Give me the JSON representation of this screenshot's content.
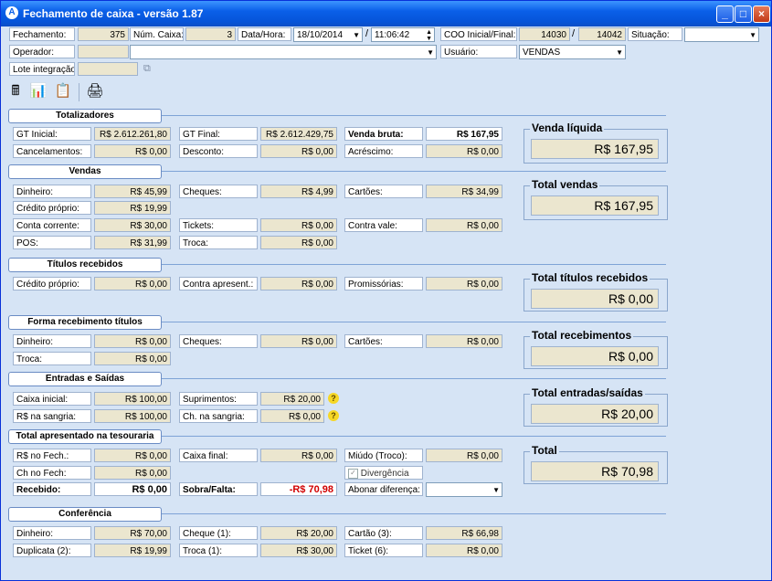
{
  "window": {
    "title": "Fechamento de caixa - versão 1.87"
  },
  "header": {
    "fechamento_label": "Fechamento:",
    "fechamento_value": "375",
    "num_caixa_label": "Núm. Caixa:",
    "num_caixa_value": "3",
    "data_hora_label": "Data/Hora:",
    "date_value": "18/10/2014",
    "date_sep": "/",
    "time_value": "11:06:42",
    "coo_label": "COO Inicial/Final:",
    "coo_inicial": "14030",
    "coo_sep": "/",
    "coo_final": "14042",
    "situacao_label": "Situação:",
    "situacao_value": "",
    "operador_label": "Operador:",
    "operador_value": "",
    "usuario_label": "Usuário:",
    "usuario_value": "VENDAS",
    "lote_label": "Lote integração:",
    "lote_value": ""
  },
  "sections": {
    "totalizadores": "Totalizadores",
    "vendas": "Vendas",
    "titulos": "Títulos recebidos",
    "forma": "Forma recebimento títulos",
    "entradas": "Entradas e Saídas",
    "tesouraria": "Total apresentado na tesouraria",
    "conferencia": "Conferência"
  },
  "totalizadores": {
    "gt_inicial_label": "GT Inicial:",
    "gt_inicial": "R$ 2.612.261,80",
    "gt_final_label": "GT Final:",
    "gt_final": "R$ 2.612.429,75",
    "venda_bruta_label": "Venda bruta:",
    "venda_bruta": "R$ 167,95",
    "cancelamentos_label": "Cancelamentos:",
    "cancelamentos": "R$ 0,00",
    "desconto_label": "Desconto:",
    "desconto": "R$ 0,00",
    "acrescimo_label": "Acréscimo:",
    "acrescimo": "R$ 0,00"
  },
  "vendas": {
    "dinheiro_label": "Dinheiro:",
    "dinheiro": "R$ 45,99",
    "cheques_label": "Cheques:",
    "cheques": "R$ 4,99",
    "cartoes_label": "Cartões:",
    "cartoes": "R$ 34,99",
    "credito_label": "Crédito próprio:",
    "credito": "R$ 19,99",
    "conta_label": "Conta corrente:",
    "conta": "R$ 30,00",
    "tickets_label": "Tickets:",
    "tickets": "R$ 0,00",
    "contravale_label": "Contra vale:",
    "contravale": "R$ 0,00",
    "pos_label": "POS:",
    "pos": "R$ 31,99",
    "troca_label": "Troca:",
    "troca": "R$ 0,00"
  },
  "titulos": {
    "credito_label": "Crédito próprio:",
    "credito": "R$ 0,00",
    "contra_label": "Contra apresent.:",
    "contra": "R$ 0,00",
    "promissorias_label": "Promissórias:",
    "promissorias": "R$ 0,00"
  },
  "forma": {
    "dinheiro_label": "Dinheiro:",
    "dinheiro": "R$ 0,00",
    "cheques_label": "Cheques:",
    "cheques": "R$ 0,00",
    "cartoes_label": "Cartões:",
    "cartoes": "R$ 0,00",
    "troca_label": "Troca:",
    "troca": "R$ 0,00"
  },
  "entradas": {
    "caixa_inicial_label": "Caixa inicial:",
    "caixa_inicial": "R$ 100,00",
    "suprimentos_label": "Suprimentos:",
    "suprimentos": "R$ 20,00",
    "sangria_label": "R$  na sangria:",
    "sangria": "R$ 100,00",
    "ch_sangria_label": "Ch. na sangria:",
    "ch_sangria": "R$ 0,00"
  },
  "tesouraria": {
    "fech_label": "R$ no Fech.:",
    "fech": "R$ 0,00",
    "caixa_final_label": "Caixa final:",
    "caixa_final": "R$ 0,00",
    "miudo_label": "Miúdo (Troco):",
    "miudo": "R$ 0,00",
    "ch_fech_label": "Ch no Fech:",
    "ch_fech": "R$ 0,00",
    "divergencia_label": "Divergência",
    "recebido_label": "Recebido:",
    "recebido": "R$ 0,00",
    "sobra_label": "Sobra/Falta:",
    "sobra": "-R$ 70,98",
    "abonar_label": "Abonar diferença:",
    "abonar_value": ""
  },
  "conferencia": {
    "dinheiro_label": "Dinheiro:",
    "dinheiro": "R$ 70,00",
    "cheque_label": "Cheque (1):",
    "cheque": "R$ 20,00",
    "cartao_label": "Cartão (3):",
    "cartao": "R$ 66,98",
    "duplicata_label": "Duplicata (2):",
    "duplicata": "R$ 19,99",
    "troca_label": "Troca (1):",
    "troca": "R$ 30,00",
    "ticket_label": "Ticket (6):",
    "ticket": "R$ 0,00"
  },
  "totals": {
    "venda_liquida_title": "Venda líquida",
    "venda_liquida": "R$ 167,95",
    "total_vendas_title": "Total vendas",
    "total_vendas": "R$ 167,95",
    "total_titulos_title": "Total títulos recebidos",
    "total_titulos": "R$ 0,00",
    "total_recebimentos_title": "Total recebimentos",
    "total_recebimentos": "R$ 0,00",
    "total_entradas_title": "Total entradas/saídas",
    "total_entradas": "R$ 20,00",
    "total_title": "Total",
    "total": "R$ 70,98"
  },
  "icons": {
    "minimize": "minimize-icon",
    "maximize": "maximize-icon",
    "close": "close-icon",
    "calculator": "calculator-icon",
    "report": "report-icon",
    "document": "document-icon",
    "printer": "printer-icon",
    "help": "help-icon"
  }
}
